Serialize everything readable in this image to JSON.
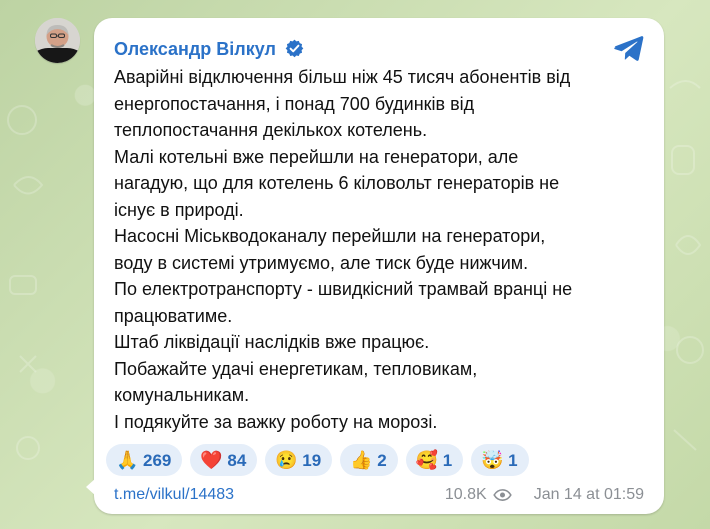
{
  "post": {
    "author": "Олександр Вілкул",
    "messageLines": [
      "Аварійні відключення більш ніж 45 тисяч абонентів від",
      "енергопостачання, і понад 700 будинків від",
      "теплопостачання декількох котелень.",
      "Малі котельні вже перейшли на генератори, але",
      "нагадую, що для котелень 6 кіловольт генераторів не",
      "існує в природі.",
      "Насосні Міськводоканалу перейшли на генератори,",
      "воду в системі утримуємо, але тиск буде нижчим.",
      "По електротранспорту - швидкісний трамвай вранці не",
      "працюватиме.",
      "Штаб ліквідації наслідків вже працює.",
      "Побажайте удачі енергетикам, тепловикам,",
      "комунальникам.",
      "І подякуйте за важку роботу на морозі."
    ],
    "reactions": [
      {
        "emoji": "🙏",
        "count": "269"
      },
      {
        "emoji": "❤️",
        "count": "84"
      },
      {
        "emoji": "😢",
        "count": "19"
      },
      {
        "emoji": "👍",
        "count": "2"
      },
      {
        "emoji": "🥰",
        "count": "1"
      },
      {
        "emoji": "🤯",
        "count": "1"
      }
    ],
    "link": "t.me/vilkul/14483",
    "views": "10.8K",
    "date": "Jan 14 at 01:59"
  },
  "icons": {
    "verified": "verified-badge-icon",
    "telegram": "telegram-icon",
    "views": "eye-icon"
  },
  "colors": {
    "accent": "#2b72c8",
    "reactionBg": "#e5eef9",
    "card": "#ffffff",
    "background": "#c9dcae"
  }
}
